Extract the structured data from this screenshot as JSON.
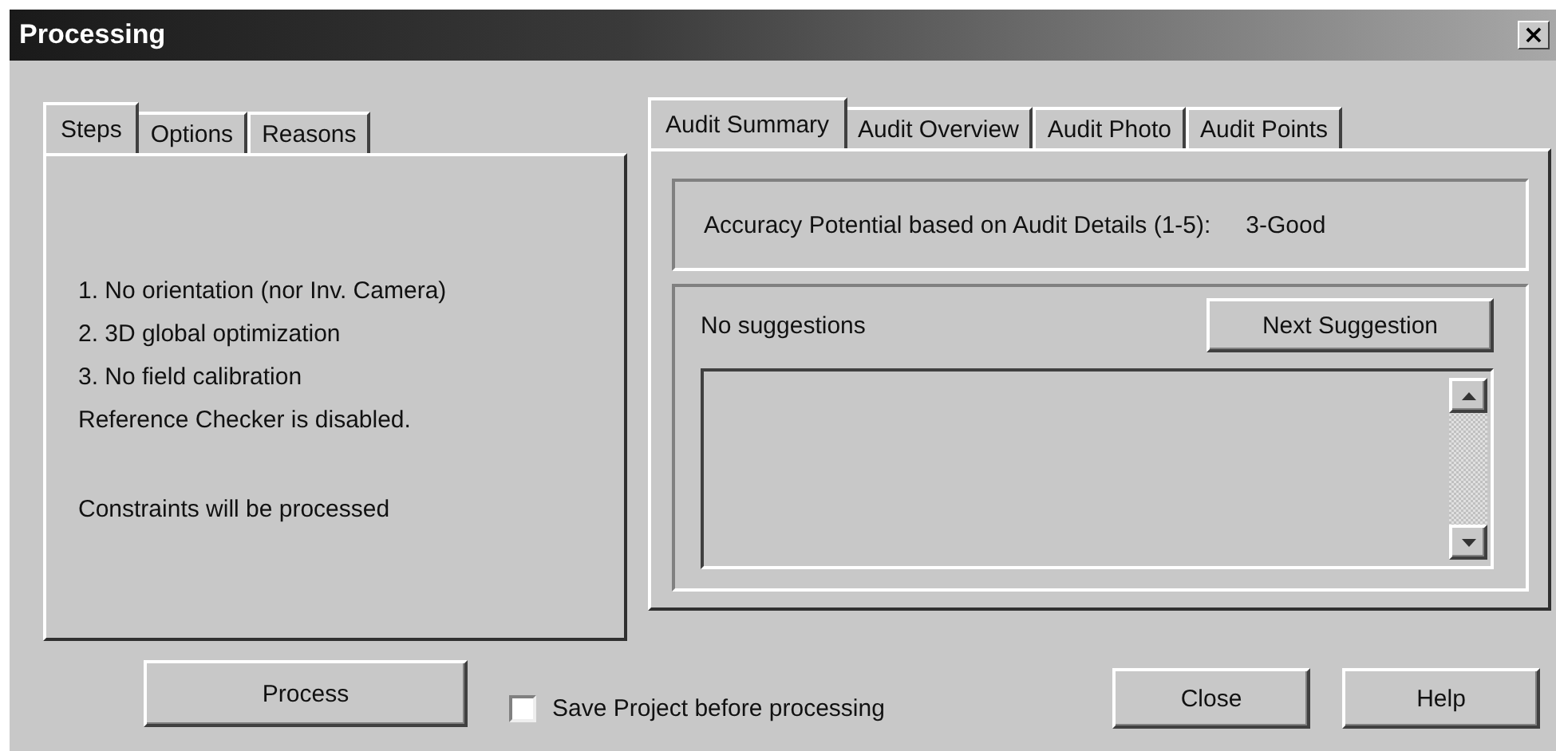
{
  "window": {
    "title": "Processing",
    "close": "×"
  },
  "left_tabs": [
    {
      "label": "Steps",
      "selected": true
    },
    {
      "label": "Options",
      "selected": false
    },
    {
      "label": "Reasons",
      "selected": false
    }
  ],
  "steps": [
    "1. No orientation (nor Inv. Camera)",
    "2. 3D global optimization",
    "3. No field calibration",
    "Reference Checker is disabled."
  ],
  "constraints_note": "Constraints will be processed",
  "right_tabs": [
    {
      "label": "Audit Summary",
      "selected": true
    },
    {
      "label": "Audit Overview",
      "selected": false
    },
    {
      "label": "Audit Photo",
      "selected": false
    },
    {
      "label": "Audit Points",
      "selected": false
    }
  ],
  "accuracy": {
    "label": "Accuracy Potential based on Audit Details (1-5):",
    "value": "3-Good"
  },
  "suggestions": {
    "status": "No suggestions",
    "button": "Next Suggestion"
  },
  "process_button": "Process",
  "save_checkbox": {
    "label": "Save Project before processing",
    "checked": false
  },
  "buttons": [
    "Close",
    "Help"
  ]
}
